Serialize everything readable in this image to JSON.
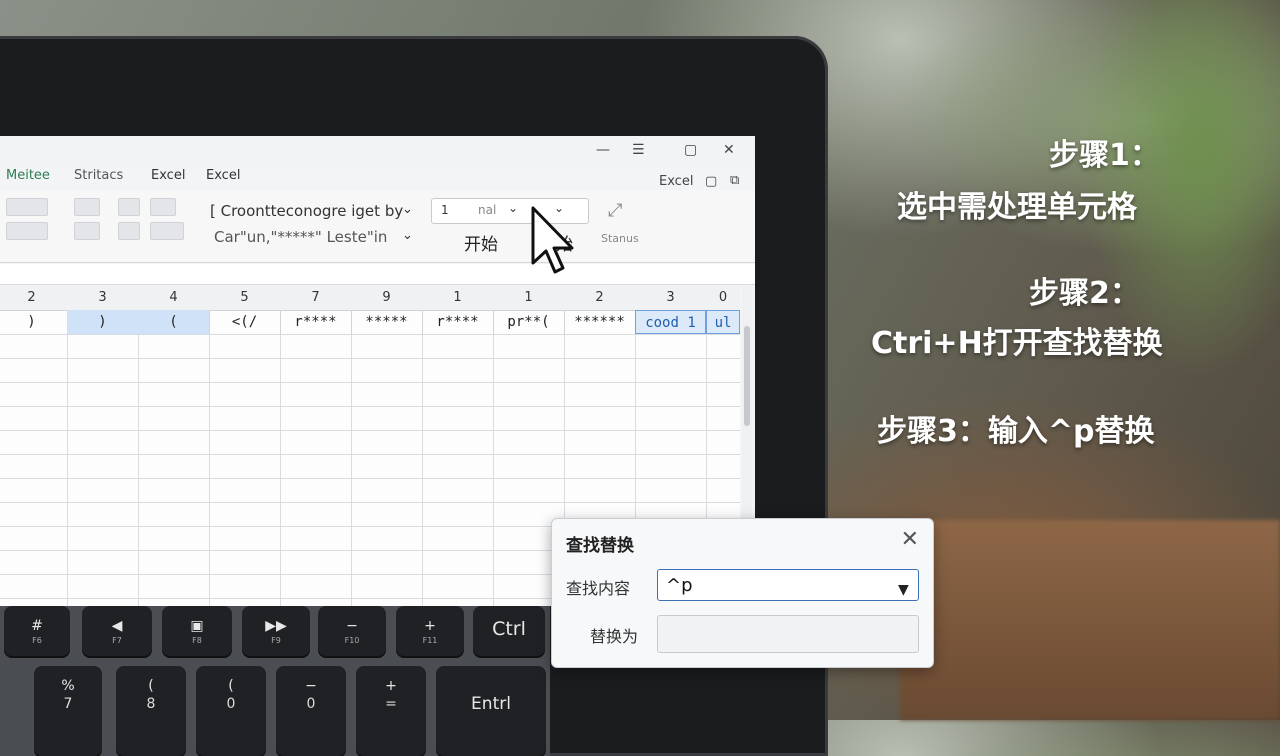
{
  "menubar": {
    "items": [
      "Meitee",
      "Stritacs",
      "Excel",
      "Excel"
    ]
  },
  "ribbon": {
    "font_line1": "[ Croontteconogre iget by",
    "font_line2": "Car\"un,\"*****\" Leste\"in",
    "start_label_1": "开始",
    "start_label_2": "开始",
    "status_label": "Stanus",
    "excel_tag": "Excel",
    "small_dd_left": "1",
    "small_dd_mid": "nal"
  },
  "sheet": {
    "col_headers": [
      "2",
      "3",
      "4",
      "5",
      "7",
      "9",
      "1",
      "1",
      "2",
      "3",
      "0"
    ],
    "row1": [
      ")",
      ")",
      "(",
      "<(/",
      "r****",
      "*****",
      "r****",
      "pr**(",
      "******",
      "cood 1",
      "ul"
    ]
  },
  "keyboard": {
    "row1": [
      {
        "label": "#",
        "sub": "F6"
      },
      {
        "label": "◀",
        "sub": "F7"
      },
      {
        "label": "▣",
        "sub": "F8"
      },
      {
        "label": "▶▶",
        "sub": "F9"
      },
      {
        "label": "−",
        "sub": "F10"
      },
      {
        "label": "+",
        "sub": "F11"
      },
      {
        "label": "Ctrl",
        "sub": ""
      }
    ],
    "row2": [
      {
        "label": "%",
        "sub": "7"
      },
      {
        "label": "(",
        "sub": "8"
      },
      {
        "label": "(",
        "sub": "0"
      },
      {
        "label": "−",
        "sub": "0"
      },
      {
        "label": "+",
        "sub": "="
      },
      {
        "label": "Entrl",
        "sub": ""
      }
    ]
  },
  "dialog": {
    "title": "查找替换",
    "find_label": "查找内容",
    "find_value": "^p",
    "replace_label": "替换为",
    "replace_value": ""
  },
  "steps": {
    "step1_title": "步骤1：",
    "step1_text": "选中需处理单元格",
    "step2_title": "步骤2：",
    "step2_text": "Ctri+H打开查找替换",
    "step3_text": "步骤3：输入^p替换"
  }
}
